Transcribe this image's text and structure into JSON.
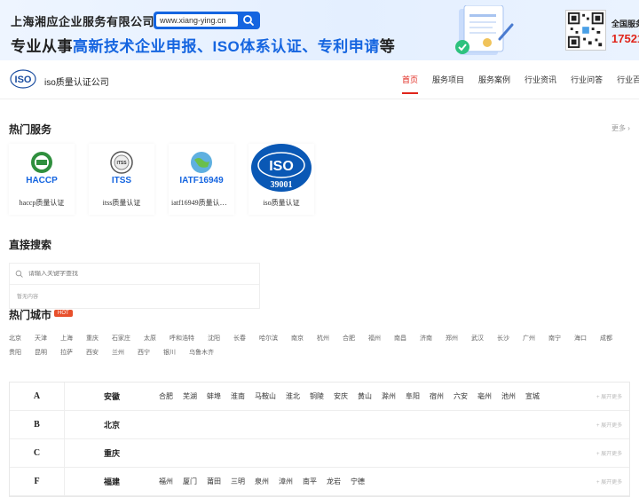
{
  "banner": {
    "company": "上海湘应企业服务有限公司",
    "url": "www.xiang-ying.cn",
    "slogan_pre": "专业从事",
    "slogan_hl": "高新技术企业申报、ISO体系认证、专利申请",
    "slogan_post": "等",
    "hotline_label": "全国服务",
    "hotline": "17521"
  },
  "nav": {
    "logo": "ISO",
    "site_name": "iso质量认证公司",
    "menu": [
      "首页",
      "服务项目",
      "服务案例",
      "行业资讯",
      "行业问答",
      "行业百科"
    ]
  },
  "hot_services": {
    "title": "热门服务",
    "more": "更多",
    "items": [
      {
        "label": "HACCP",
        "caption": "haccp质量认证"
      },
      {
        "label": "ITSS",
        "caption": "itss质量认证"
      },
      {
        "label": "IATF16949",
        "caption": "iatf16949质量认证..."
      },
      {
        "label": "ISO",
        "sub": "39001",
        "caption": "iso质量认证"
      }
    ]
  },
  "direct_search": {
    "title": "直接搜索",
    "placeholder": "请输入关键字查找",
    "empty": "暂无内容"
  },
  "hot_cities": {
    "title": "热门城市",
    "badge": "HOT",
    "cities": [
      "北京",
      "天津",
      "上海",
      "重庆",
      "石家庄",
      "太原",
      "呼和浩特",
      "沈阳",
      "长春",
      "哈尔滨",
      "南京",
      "杭州",
      "合肥",
      "福州",
      "南昌",
      "济南",
      "郑州",
      "武汉",
      "长沙",
      "广州",
      "南宁",
      "海口",
      "成都",
      "贵阳",
      "昆明",
      "拉萨",
      "西安",
      "兰州",
      "西宁",
      "银川",
      "乌鲁木齐"
    ]
  },
  "province_table": {
    "expand_label": "展开更多",
    "rows": [
      {
        "letter": "A",
        "province": "安徽",
        "cities": [
          "合肥",
          "芜湖",
          "蚌埠",
          "淮南",
          "马鞍山",
          "淮北",
          "铜陵",
          "安庆",
          "黄山",
          "滁州",
          "阜阳",
          "宿州",
          "六安",
          "亳州",
          "池州",
          "宣城"
        ]
      },
      {
        "letter": "B",
        "province": "北京",
        "cities": []
      },
      {
        "letter": "C",
        "province": "重庆",
        "cities": []
      },
      {
        "letter": "F",
        "province": "福建",
        "cities": [
          "福州",
          "厦门",
          "莆田",
          "三明",
          "泉州",
          "漳州",
          "南平",
          "龙岩",
          "宁德"
        ]
      }
    ]
  },
  "colors": {
    "accent": "#e0251b",
    "brand": "#1565e0"
  }
}
